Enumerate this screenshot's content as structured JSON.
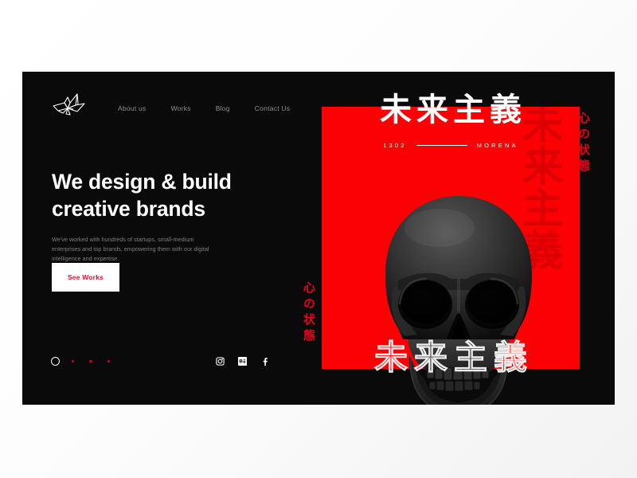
{
  "site": {
    "logo_icon": "origami-crane-logo-icon"
  },
  "nav": {
    "items": [
      {
        "label": "About us"
      },
      {
        "label": "Works"
      },
      {
        "label": "Blog"
      },
      {
        "label": "Contact Us"
      }
    ]
  },
  "hero": {
    "headline": "We design & build\ncreative brands",
    "subcopy": "We've worked with hundreds of startups, small-medium enterprises and top brands, empowering them with our digital intelligence and expertise.",
    "cta_label": "See Works"
  },
  "pager": {
    "dots": [
      {
        "state": "active"
      },
      {
        "state": "inactive"
      },
      {
        "state": "inactive"
      },
      {
        "state": "inactive"
      }
    ]
  },
  "social": {
    "items": [
      {
        "icon": "instagram-icon",
        "name": "Instagram"
      },
      {
        "icon": "behance-icon",
        "name": "Behance"
      },
      {
        "icon": "facebook-icon",
        "name": "Facebook"
      }
    ]
  },
  "poster": {
    "jp_title": "未来主義",
    "meta_left": "1302",
    "meta_right": "MORENA",
    "vertical_text_right": "心の状態",
    "vertical_text_left": "心の状態",
    "background_text": "未来主義",
    "outline_title": "未来主義",
    "art_alt": "dark-skull-render"
  },
  "colors": {
    "canvas": "#0a0a0a",
    "panel_red": "#fb0104",
    "accent_red": "#e8112d",
    "text_white": "#ffffff",
    "text_muted": "#7d7d7d",
    "nav_muted": "#8e8e8e"
  }
}
